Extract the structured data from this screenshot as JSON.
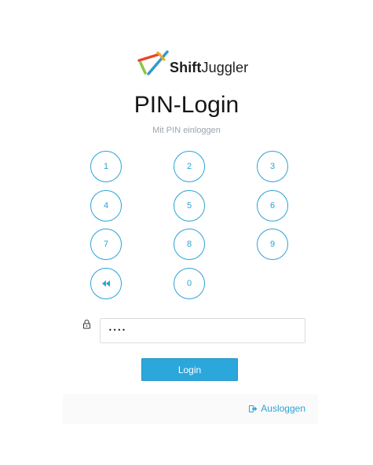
{
  "brand": {
    "name_prefix": "Shift",
    "name_suffix": "Juggler"
  },
  "header": {
    "title": "PIN-Login",
    "subtitle": "Mit PIN einloggen"
  },
  "keypad": {
    "keys": [
      "1",
      "2",
      "3",
      "4",
      "5",
      "6",
      "7",
      "8",
      "9",
      "0"
    ],
    "backspace_icon": "double-chevron-left-icon"
  },
  "pin_field": {
    "value": "••••",
    "icon": "lock-icon"
  },
  "actions": {
    "login_label": "Login",
    "logout_label": "Ausloggen",
    "logout_icon": "sign-out-icon"
  },
  "colors": {
    "accent": "#2aa3d6",
    "button": "#2ba7dc",
    "logo_red": "#e8462a",
    "logo_orange": "#f5a623",
    "logo_blue": "#3399cc",
    "logo_green": "#8cc63f"
  }
}
